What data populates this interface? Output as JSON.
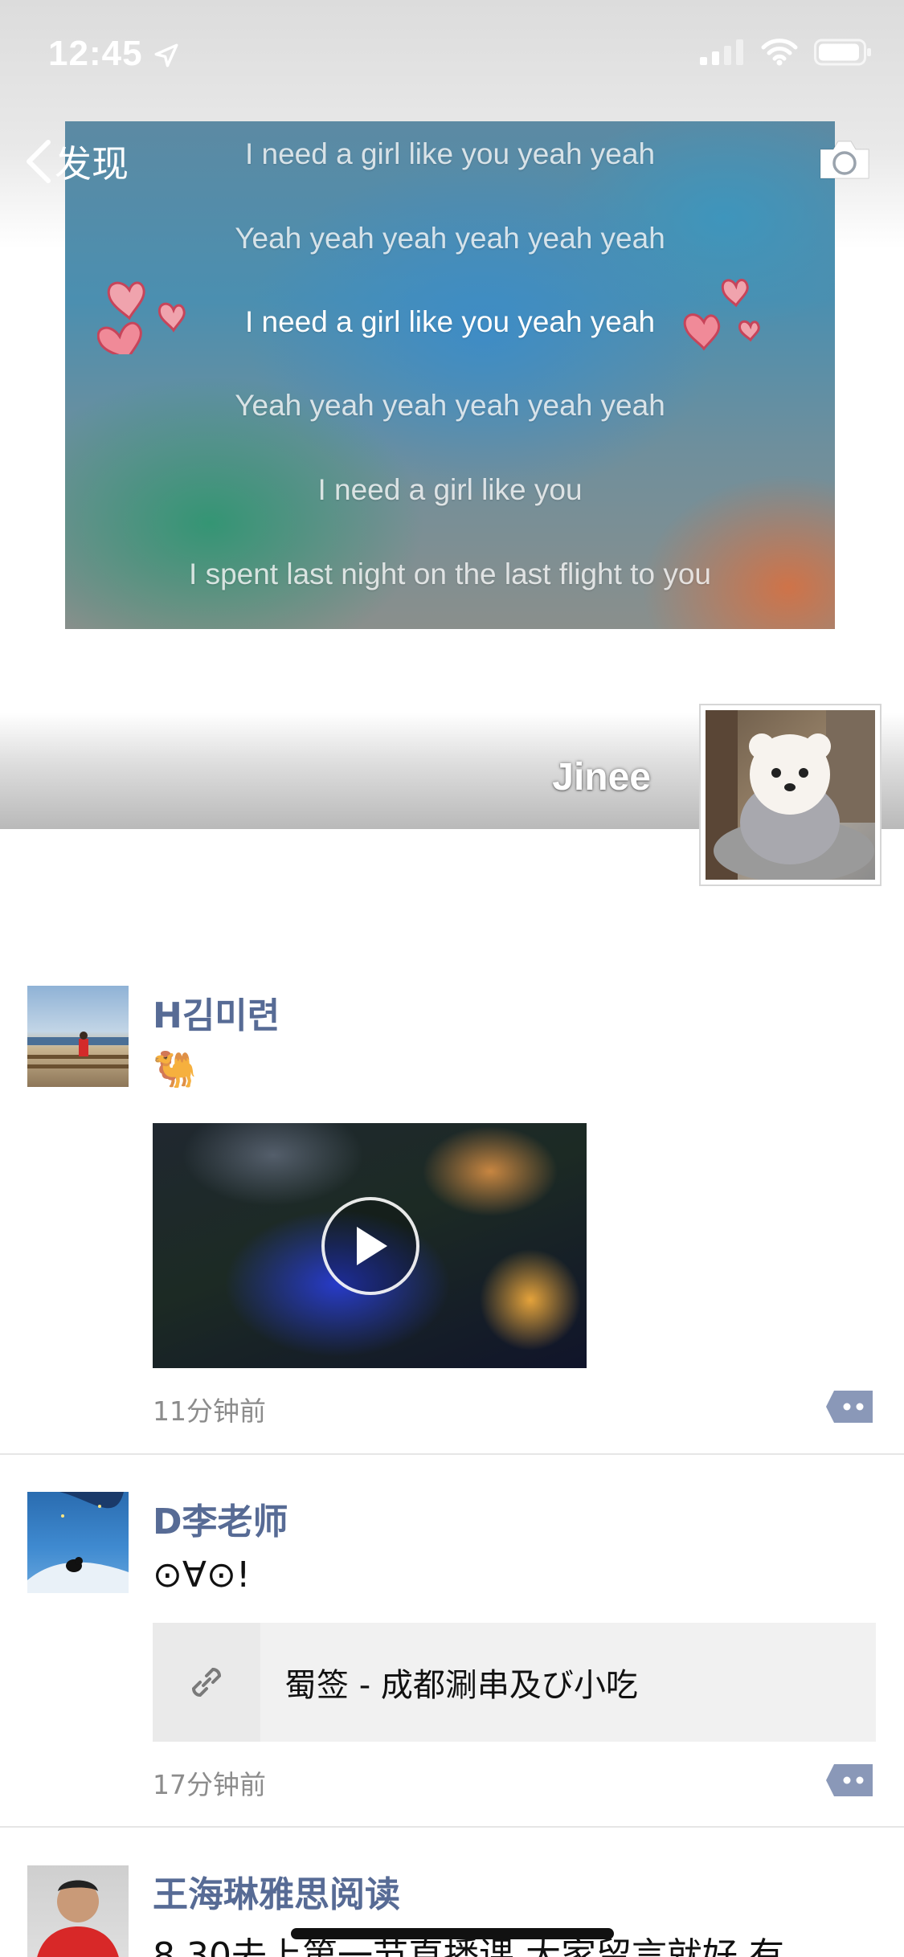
{
  "status_bar": {
    "time": "12:45"
  },
  "nav": {
    "back_label": "发现"
  },
  "cover": {
    "lyrics": [
      "I need a girl like you yeah yeah",
      "Yeah yeah yeah yeah yeah yeah",
      "I need a girl like you yeah yeah",
      "Yeah yeah yeah yeah yeah yeah",
      "I need a girl like you",
      "I spent last night on the last flight to you"
    ],
    "username": "Jinee"
  },
  "posts": [
    {
      "name": "H김미련",
      "text": "🐫",
      "time": "11分钟前",
      "media": "video"
    },
    {
      "name": "D李老师",
      "text": "⊙∀⊙!",
      "link_title": "蜀签 - 成都涮串及び小吃",
      "time": "17分钟前"
    },
    {
      "name": "王海琳雅思阅读",
      "text": "8.30去上第一节直播课 大家留言就好 有"
    }
  ],
  "colors": {
    "name_link": "#576b95",
    "time_gray": "#8c8c8c",
    "comment_button": "#8a98b8"
  }
}
